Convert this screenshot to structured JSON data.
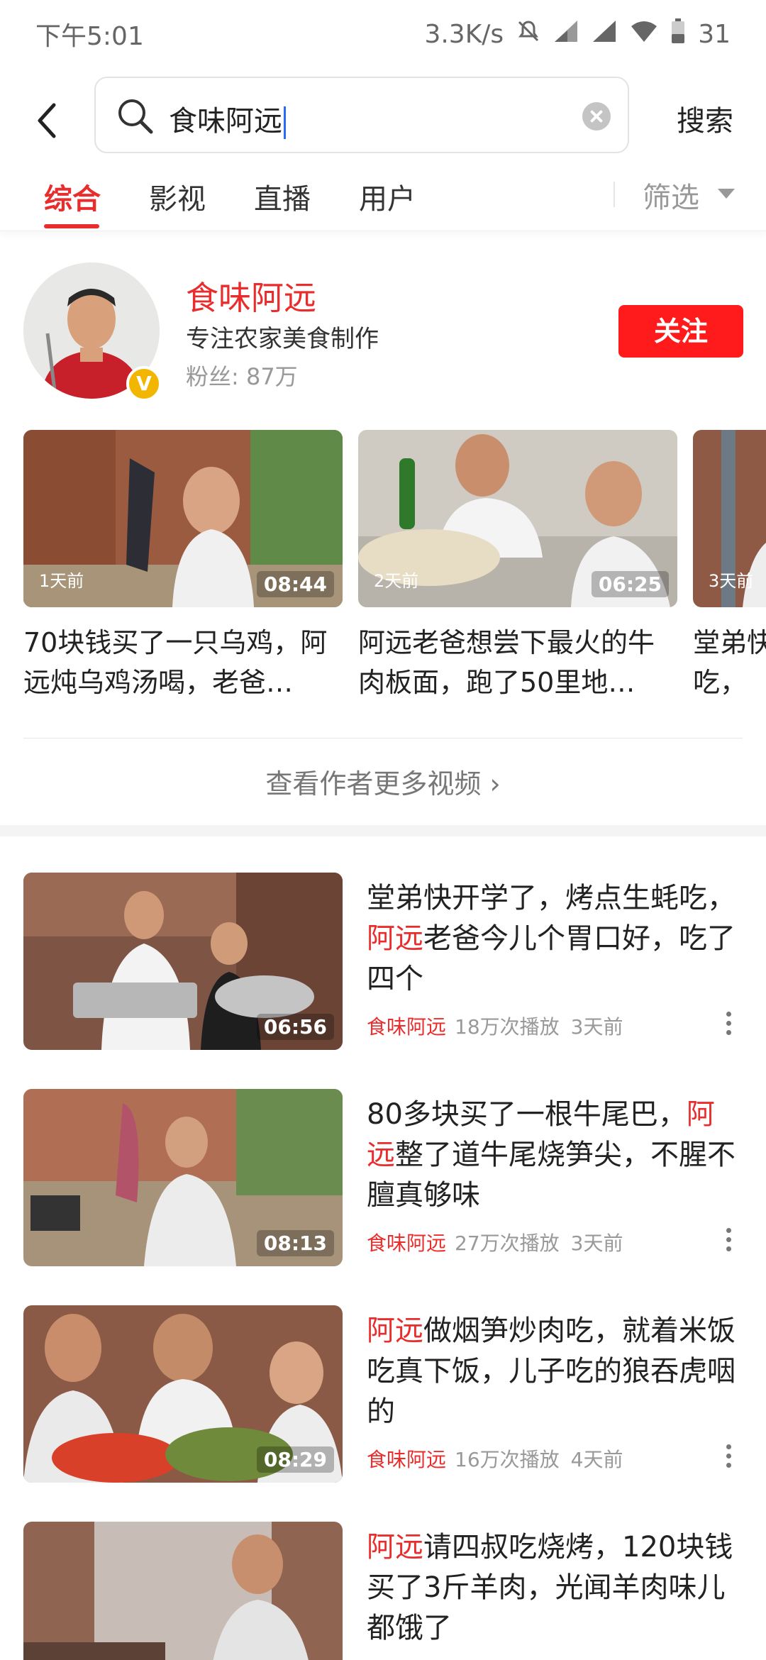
{
  "status_bar": {
    "time": "下午5:01",
    "net_speed": "3.3K/s",
    "battery": "31"
  },
  "search": {
    "query": "食味阿远",
    "button_label": "搜索"
  },
  "tabs": [
    {
      "label": "综合",
      "active": true
    },
    {
      "label": "影视",
      "active": false
    },
    {
      "label": "直播",
      "active": false
    },
    {
      "label": "用户",
      "active": false
    }
  ],
  "filter_label": "筛选",
  "author": {
    "name": "食味阿远",
    "description": "专注农家美食制作",
    "fans": "粉丝: 87万",
    "verified_badge": "V",
    "follow_label": "关注",
    "videos": [
      {
        "ago": "1天前",
        "duration": "08:44",
        "title": "70块钱买了一只乌鸡，阿远炖乌鸡汤喝，老爸…"
      },
      {
        "ago": "2天前",
        "duration": "06:25",
        "title": "阿远老爸想尝下最火的牛肉板面，跑了50里地…"
      },
      {
        "ago": "3天前",
        "duration": "",
        "title": "堂弟快开学了，烤点生蚝吃，"
      }
    ],
    "more_label": "查看作者更多视频 ›"
  },
  "results": [
    {
      "title_parts": [
        "堂弟快开学了，烤点生蚝吃，",
        "阿远",
        "老爸今儿个胃口好，吃了四个"
      ],
      "author": "食味阿远",
      "plays": "18万次播放",
      "ago": "3天前",
      "duration": "06:56"
    },
    {
      "title_parts": [
        "80多块买了一根牛尾巴，",
        "阿远",
        "整了道牛尾烧笋尖，不腥不膻真够味"
      ],
      "author": "食味阿远",
      "plays": "27万次播放",
      "ago": "3天前",
      "duration": "08:13"
    },
    {
      "title_parts": [
        "",
        "阿远",
        "做烟笋炒肉吃，就着米饭吃真下饭，儿子吃的狼吞虎咽的"
      ],
      "author": "食味阿远",
      "plays": "16万次播放",
      "ago": "4天前",
      "duration": "08:29"
    },
    {
      "title_parts": [
        "",
        "阿远",
        "请四叔吃烧烤，120块钱买了3斤羊肉，光闻羊肉味儿都饿了"
      ],
      "author": "",
      "plays": "",
      "ago": "",
      "duration": ""
    }
  ],
  "colors": {
    "accent": "#e92d2d",
    "follow_bg": "#ff1b1b",
    "badge": "#f3b600"
  },
  "icons": [
    "back-arrow-icon",
    "search-icon",
    "clear-icon",
    "filter-dropdown-icon",
    "more-vertical-icon",
    "mute-icon",
    "signal-icon",
    "wifi-icon",
    "battery-icon"
  ]
}
